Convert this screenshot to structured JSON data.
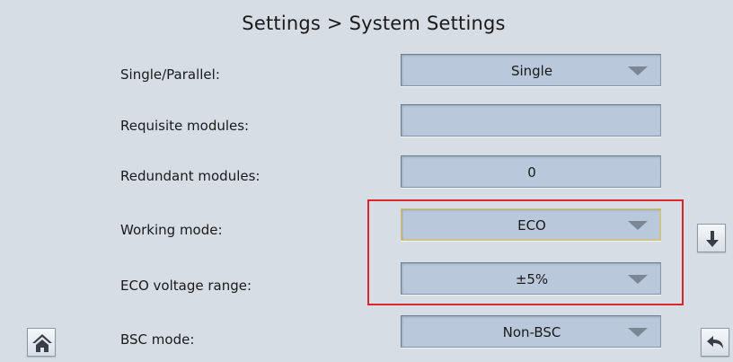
{
  "header": {
    "title": "Settings > System Settings"
  },
  "rows": [
    {
      "label": "Single/Parallel:",
      "value": "Single"
    },
    {
      "label": "Requisite modules:",
      "value": ""
    },
    {
      "label": "Redundant modules:",
      "value": "0"
    },
    {
      "label": "Working mode:",
      "value": "ECO"
    },
    {
      "label": "ECO voltage range:",
      "value": "±5%"
    },
    {
      "label": "BSC mode:",
      "value": "Non-BSC"
    }
  ],
  "colors": {
    "panel_background": "#d6dde5",
    "field_background": "#b9c8da",
    "highlight_border": "#d9262a",
    "focus_border": "#e0c24a"
  },
  "icons": {
    "scroll_down": "arrow-down-icon",
    "home": "home-icon",
    "back": "back-icon",
    "dropdown": "dropdown-arrow-icon"
  }
}
